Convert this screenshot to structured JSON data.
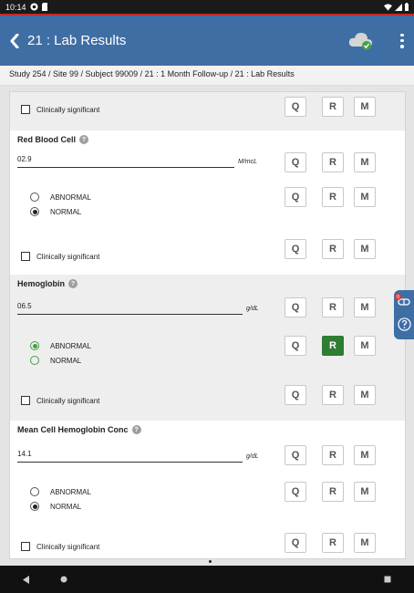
{
  "statusbar": {
    "time": "10:14"
  },
  "appbar": {
    "title": "21 : Lab Results",
    "icons": [
      "back-chevron-icon",
      "cloud-sync-icon",
      "more-vert-icon"
    ]
  },
  "breadcrumb": "Study 254 / Site 99 / Subject 99009 / 21 : 1 Month Follow-up / 21 : Lab Results",
  "buttons": {
    "q": "Q",
    "r": "R",
    "m": "M"
  },
  "colors": {
    "appbar": "#3f6ea5",
    "active_r": "#2e7d32",
    "radio_green": "#43a047"
  },
  "top_section": {
    "clinically_significant": "Clinically significant"
  },
  "sections": [
    {
      "label": "Red Blood Cell",
      "value": "02.9",
      "unit": "M/mcL",
      "options": [
        "ABNORMAL",
        "NORMAL"
      ],
      "selected": "NORMAL",
      "clinically_significant": "Clinically significant"
    },
    {
      "label": "Hemoglobin",
      "value": "06.5",
      "unit": "g/dL",
      "options": [
        "ABNORMAL",
        "NORMAL"
      ],
      "selected": "ABNORMAL",
      "clinically_significant": "Clinically significant"
    },
    {
      "label": "Mean Cell Hemoglobin Conc",
      "value": "14.1",
      "unit": "g/dL",
      "options": [
        "ABNORMAL",
        "NORMAL"
      ],
      "selected": "NORMAL",
      "clinically_significant": "Clinically significant"
    }
  ],
  "sidetab": {
    "badge": "0"
  }
}
